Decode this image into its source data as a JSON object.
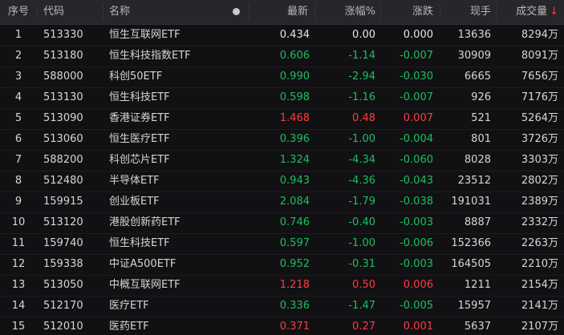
{
  "header": {
    "index": "序号",
    "code": "代码",
    "name": "名称",
    "dot_icon": "filled-circle",
    "price": "最新",
    "pct": "涨幅%",
    "change": "涨跌",
    "volume_now": "现手",
    "volume": "成交量",
    "sort_arrow": "↓"
  },
  "colors": {
    "up": "#ff3b3b",
    "down": "#19c05a",
    "flat": "#e6e6e6"
  },
  "rows": [
    {
      "index": "1",
      "code": "513330",
      "name": "恒生互联网ETF",
      "price": "0.434",
      "pct": "0.00",
      "change": "0.000",
      "now": "13636",
      "volume": "8294万",
      "dir": "flat"
    },
    {
      "index": "2",
      "code": "513180",
      "name": "恒生科技指数ETF",
      "price": "0.606",
      "pct": "-1.14",
      "change": "-0.007",
      "now": "30909",
      "volume": "8091万",
      "dir": "down"
    },
    {
      "index": "3",
      "code": "588000",
      "name": "科创50ETF",
      "price": "0.990",
      "pct": "-2.94",
      "change": "-0.030",
      "now": "6665",
      "volume": "7656万",
      "dir": "down"
    },
    {
      "index": "4",
      "code": "513130",
      "name": "恒生科技ETF",
      "price": "0.598",
      "pct": "-1.16",
      "change": "-0.007",
      "now": "926",
      "volume": "7176万",
      "dir": "down"
    },
    {
      "index": "5",
      "code": "513090",
      "name": "香港证券ETF",
      "price": "1.468",
      "pct": "0.48",
      "change": "0.007",
      "now": "521",
      "volume": "5264万",
      "dir": "up"
    },
    {
      "index": "6",
      "code": "513060",
      "name": "恒生医疗ETF",
      "price": "0.396",
      "pct": "-1.00",
      "change": "-0.004",
      "now": "801",
      "volume": "3726万",
      "dir": "down"
    },
    {
      "index": "7",
      "code": "588200",
      "name": "科创芯片ETF",
      "price": "1.324",
      "pct": "-4.34",
      "change": "-0.060",
      "now": "8028",
      "volume": "3303万",
      "dir": "down"
    },
    {
      "index": "8",
      "code": "512480",
      "name": "半导体ETF",
      "price": "0.943",
      "pct": "-4.36",
      "change": "-0.043",
      "now": "23512",
      "volume": "2802万",
      "dir": "down"
    },
    {
      "index": "9",
      "code": "159915",
      "name": "创业板ETF",
      "price": "2.084",
      "pct": "-1.79",
      "change": "-0.038",
      "now": "191031",
      "volume": "2389万",
      "dir": "down"
    },
    {
      "index": "10",
      "code": "513120",
      "name": "港股创新药ETF",
      "price": "0.746",
      "pct": "-0.40",
      "change": "-0.003",
      "now": "8887",
      "volume": "2332万",
      "dir": "down"
    },
    {
      "index": "11",
      "code": "159740",
      "name": "恒生科技ETF",
      "price": "0.597",
      "pct": "-1.00",
      "change": "-0.006",
      "now": "152366",
      "volume": "2263万",
      "dir": "down"
    },
    {
      "index": "12",
      "code": "159338",
      "name": "中证A500ETF",
      "price": "0.952",
      "pct": "-0.31",
      "change": "-0.003",
      "now": "164505",
      "volume": "2210万",
      "dir": "down"
    },
    {
      "index": "13",
      "code": "513050",
      "name": "中概互联网ETF",
      "price": "1.218",
      "pct": "0.50",
      "change": "0.006",
      "now": "1211",
      "volume": "2154万",
      "dir": "up"
    },
    {
      "index": "14",
      "code": "512170",
      "name": "医疗ETF",
      "price": "0.336",
      "pct": "-1.47",
      "change": "-0.005",
      "now": "15957",
      "volume": "2141万",
      "dir": "down"
    },
    {
      "index": "15",
      "code": "512010",
      "name": "医药ETF",
      "price": "0.371",
      "pct": "0.27",
      "change": "0.001",
      "now": "5637",
      "volume": "2107万",
      "dir": "up"
    }
  ]
}
